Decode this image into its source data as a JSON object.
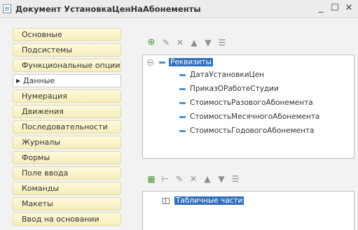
{
  "window": {
    "title": "Документ УстановкаЦенНаАбонементы",
    "minimize_icon": "minimize-icon",
    "maximize_icon": "maximize-icon",
    "close_icon": "close-icon"
  },
  "nav": {
    "items": [
      {
        "label": "Основные"
      },
      {
        "label": "Подсистемы"
      },
      {
        "label": "Функциональные опции"
      },
      {
        "label": "Данные",
        "active": true
      },
      {
        "label": "Нумерация"
      },
      {
        "label": "Движения"
      },
      {
        "label": "Последовательности"
      },
      {
        "label": "Журналы"
      },
      {
        "label": "Формы"
      },
      {
        "label": "Поле ввода"
      },
      {
        "label": "Команды"
      },
      {
        "label": "Макеты"
      },
      {
        "label": "Ввод на основании"
      }
    ]
  },
  "attributes_panel": {
    "toolbar_icons": [
      "add-icon",
      "edit-icon",
      "delete-icon",
      "move-up-icon",
      "move-down-icon",
      "list-icon"
    ],
    "root_label": "Реквизиты",
    "items": [
      {
        "label": "ДатаУстановкиЦен"
      },
      {
        "label": "ПриказОРаботеСтудии"
      },
      {
        "label": "СтоимостьРазовогоАбонемента"
      },
      {
        "label": "СтоимостьМесячногоАбонемента"
      },
      {
        "label": "СтоимостьГодовогоАбонемента"
      }
    ]
  },
  "tabular_panel": {
    "toolbar_icons": [
      "add-table-icon",
      "add-column-icon",
      "edit-icon",
      "delete-icon",
      "move-up-icon",
      "move-down-icon",
      "list-icon"
    ],
    "root_label": "Табличные части"
  }
}
